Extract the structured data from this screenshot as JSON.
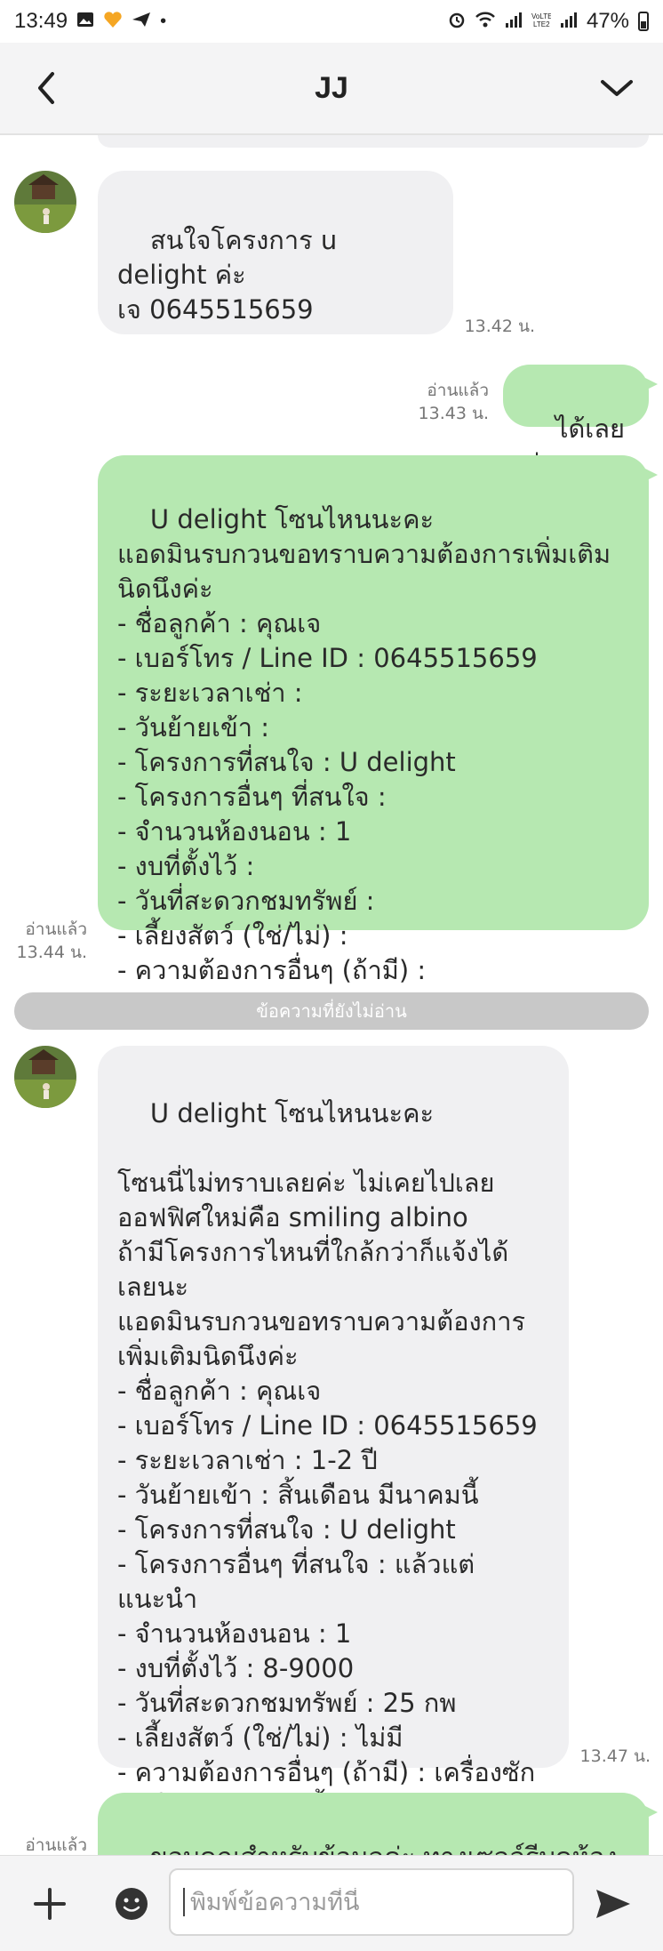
{
  "status_bar": {
    "time": "13:49",
    "battery": "47%"
  },
  "header": {
    "title": "JJ"
  },
  "messages": [
    {
      "text": "สนใจโครงการ u delight ค่ะ\nเจ 0645515659",
      "time": "13.42 น."
    },
    {
      "text": "ได้เลยค่ะ",
      "read": "อ่านแล้ว",
      "time": "13.43 น."
    },
    {
      "text": "U delight โซนไหนนะคะ\nแอดมินรบกวนขอทราบความต้องการเพิ่มเติม\nนิดนึงค่ะ\n- ชื่อลูกค้า : คุณเจ\n- เบอร์โทร / Line ID : 0645515659\n- ระยะเวลาเช่า :\n- วันย้ายเข้า :\n- โครงการที่สนใจ : U delight\n- โครงการอื่นๆ ที่สนใจ :\n- จำนวนห้องนอน : 1\n- งบที่ตั้งไว้ :\n- วันที่สะดวกชมทรัพย์ :\n- เลี้ยงสัตว์ (ใช่/ไม่) :\n- ความต้องการอื่นๆ (ถ้ามี) :",
      "read": "อ่านแล้ว",
      "time": "13.44 น."
    },
    {
      "text": "U delight โซนไหนนะคะ\n\nโซนนี่ไม่ทราบเลยค่ะ ไม่เคยไปเลย\nออฟฟิศใหม่คือ smiling albino\nถ้ามีโครงการไหนที่ใกล้กว่าก็แจ้งได้\nเลยนะ\nแอดมินรบกวนขอทราบความต้องการ\nเพิ่มเติมนิดนึงค่ะ\n- ชื่อลูกค้า : คุณเจ\n- เบอร์โทร / Line ID : 0645515659\n- ระยะเวลาเช่า : 1-2 ปี\n- วันย้ายเข้า : สิ้นเดือน มีนาคมนี้\n- โครงการที่สนใจ : U delight\n- โครงการอื่นๆ ที่สนใจ : แล้วแต่แนะนำ\n- จำนวนห้องนอน : 1\n- งบที่ตั้งไว้ : 8-9000\n- วันที่สะดวกชมทรัพย์ : 25 กพ\n- เลี้ยงสัตว์ (ใช่/ไม่) : ไม่มี\n- ความต้องการอื่นๆ (ถ้ามี) : เครื่องซัก\nผ้า ใกล้แอร์พอร์ตลิ้ง",
      "time": "13.47 น."
    },
    {
      "text": "ขอบคุณสำหรับข้อมูลค่ะ ทางเซลล์รีบดูห้อง\nให้และติดต่อกลับนะคะ",
      "read": "อ่านแล้ว"
    }
  ],
  "unread_divider": "ข้อความที่ยังไม่อ่าน",
  "composer": {
    "placeholder": "พิมพ์ข้อความที่นี่"
  },
  "colors": {
    "outgoing_bubble": "#b6e8b1",
    "incoming_bubble": "#f0f0f2",
    "header_bg": "#f4f4f5",
    "unread_bar": "#c8c8c8"
  },
  "icons": {
    "back": "chevron-left-icon",
    "menu": "chevron-down-icon",
    "add": "plus-icon",
    "emoji": "emoji-icon",
    "send": "send-icon"
  }
}
